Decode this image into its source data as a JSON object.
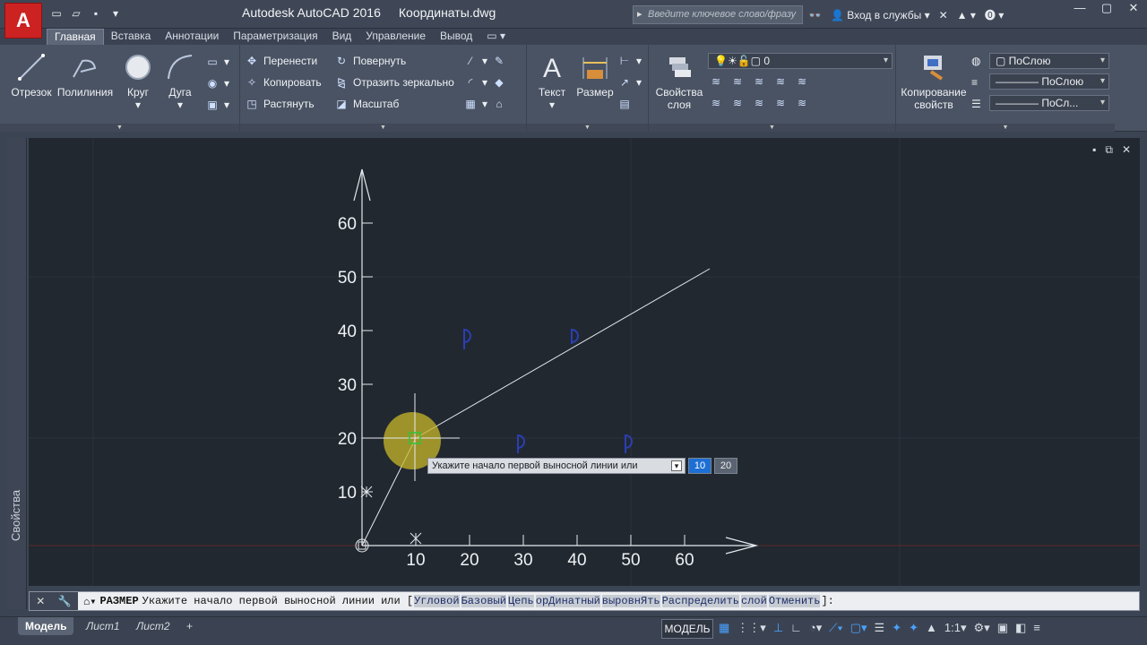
{
  "window": {
    "app_title": "Autodesk AutoCAD 2016",
    "file_title": "Координаты.dwg",
    "search_placeholder": "Введите ключевое слово/фразу",
    "signin": "Вход в службы",
    "help": "?"
  },
  "ribbon_tabs": [
    "Главная",
    "Вставка",
    "Аннотации",
    "Параметризация",
    "Вид",
    "Управление",
    "Вывод"
  ],
  "draw_panel": {
    "line": "Отрезок",
    "polyline": "Полилиния",
    "circle": "Круг",
    "arc": "Дуга"
  },
  "modify_panel": {
    "move": "Перенести",
    "copy": "Копировать",
    "stretch": "Растянуть",
    "rotate": "Повернуть",
    "mirror": "Отразить зеркально",
    "scale": "Масштаб"
  },
  "annotation_panel": {
    "text": "Текст",
    "dimension": "Размер"
  },
  "layers_panel": {
    "layer_props": "Свойства слоя",
    "current_layer": "0"
  },
  "properties_panel": {
    "match": "Копирование свойств",
    "color": "ПоСлою",
    "linetype": "ПоСлою",
    "lineweight": "ПоСл..."
  },
  "sidebar": {
    "label": "Свойства"
  },
  "drawing": {
    "y_ticks": [
      "10",
      "20",
      "30",
      "40",
      "50",
      "60"
    ],
    "x_ticks": [
      "10",
      "20",
      "30",
      "40",
      "50",
      "60"
    ],
    "tooltip": "Укажите начало первой выносной линии или",
    "dyn_x": "10",
    "dyn_y": "20"
  },
  "command_line": {
    "command": "РАЗМЕР",
    "prompt": "Укажите начало первой выносной линии или [",
    "options": [
      "Угловой",
      "Базовый",
      "Цепь",
      "орДинатный",
      "выровнЯть",
      "Распределить",
      "слой",
      "Отменить"
    ],
    "suffix": "]:"
  },
  "layout_tabs": [
    "Модель",
    "Лист1",
    "Лист2"
  ],
  "status": {
    "model": "МОДЕЛЬ",
    "scale": "1:1"
  },
  "colors": {
    "canvas": "#212830",
    "ribbon": "#4a5363",
    "accent": "#1d6fd4"
  }
}
